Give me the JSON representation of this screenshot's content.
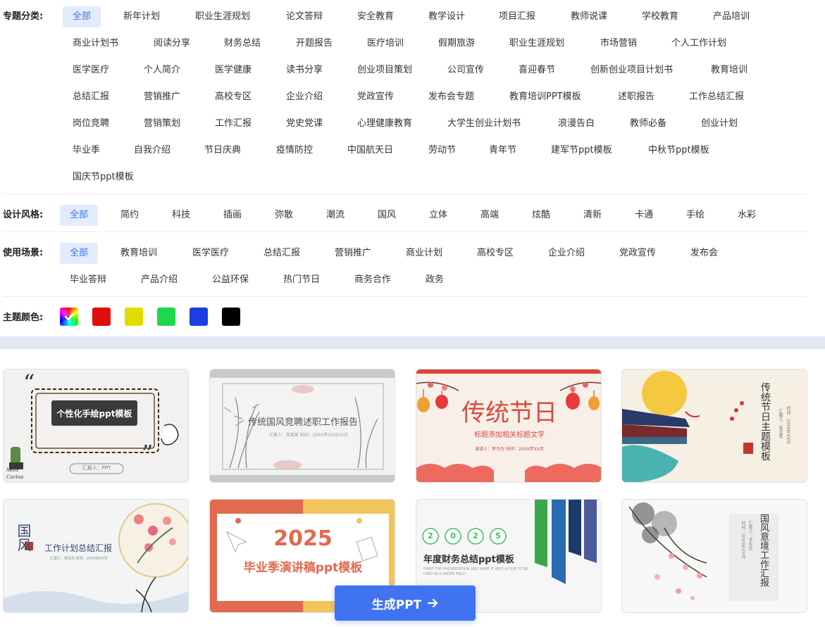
{
  "filters": {
    "topic": {
      "label": "专题分类:",
      "tags": [
        "全部",
        "新年计划",
        "职业生涯规划",
        "论文答辩",
        "安全教育",
        "教学设计",
        "项目汇报",
        "教师说课",
        "学校教育",
        "产品培训",
        "商业计划书",
        "阅读分享",
        "财务总结",
        "开题报告",
        "医疗培训",
        "假期旅游",
        "职业生涯规划",
        "市场营销",
        "个人工作计划",
        "医学医疗",
        "个人简介",
        "医学健康",
        "读书分享",
        "创业项目策划",
        "公司宣传",
        "喜迎春节",
        "创新创业项目计划书",
        "教育培训",
        "总结汇报",
        "营销推广",
        "高校专区",
        "企业介绍",
        "党政宣传",
        "发布会专题",
        "教育培训PPT模板",
        "述职报告",
        "工作总结汇报",
        "岗位竞聘",
        "营销策划",
        "工作汇报",
        "党史党课",
        "心理健康教育",
        "大学生创业计划书",
        "浪漫告白",
        "教师必备",
        "创业计划",
        "毕业季",
        "自我介绍",
        "节日庆典",
        "疫情防控",
        "中国航天日",
        "劳动节",
        "青年节",
        "建军节ppt模板",
        "中秋节ppt模板",
        "国庆节ppt模板"
      ]
    },
    "style": {
      "label": "设计风格:",
      "tags": [
        "全部",
        "简约",
        "科技",
        "插画",
        "弥散",
        "潮流",
        "国风",
        "立体",
        "高端",
        "炫酷",
        "清新",
        "卡通",
        "手绘",
        "水彩"
      ]
    },
    "scene": {
      "label": "使用场景:",
      "tags": [
        "全部",
        "教育培训",
        "医学医疗",
        "总结汇报",
        "营销推广",
        "商业计划",
        "高校专区",
        "企业介绍",
        "党政宣传",
        "发布会",
        "毕业答辩",
        "产品介绍",
        "公益环保",
        "热门节日",
        "商务合作",
        "政务"
      ]
    },
    "color": {
      "label": "主题颜色:",
      "swatches": [
        "rainbow",
        "#e00d0d",
        "#e4dc00",
        "#1ed84c",
        "#1a3fe0",
        "#000000"
      ]
    }
  },
  "cards": [
    {
      "title": "个性化手绘ppt模板",
      "sub": "汇报人：PPT",
      "extra": "hello Cactus"
    },
    {
      "title": "传统国风竞聘述职工作报告",
      "sub": "汇报人：某某某    时间：20XX年XX月XX日"
    },
    {
      "title": "传统节日",
      "sub": "标题添加相关标题文字",
      "extra": "演讲人：李为为        时间：20XX年XX月"
    },
    {
      "title": "传统节日主题模板",
      "sub": "汇报人：张云若",
      "extra": "时间：20XX年XX月"
    },
    {
      "title": "工作计划总结汇报",
      "sub": "汇报人：李杰杰    时间：20XX年XX月",
      "extra": "国风"
    },
    {
      "title": "毕业季演讲稿ppt模板",
      "sub": "2025"
    },
    {
      "title": "年度财务总结ppt模板",
      "sub": "PRINT THE PRESENTATION AND MAKE IT INTO A FILM TO BE USED IN A WIDER FIELD",
      "extra": [
        "2",
        "0",
        "2",
        "5"
      ]
    },
    {
      "title": "国风意境工作汇报",
      "sub": "汇报人：李先生",
      "extra": "时间：20XX年XX月"
    }
  ],
  "generate_button": {
    "label": "生成PPT",
    "icon": "arrow-right-icon"
  }
}
